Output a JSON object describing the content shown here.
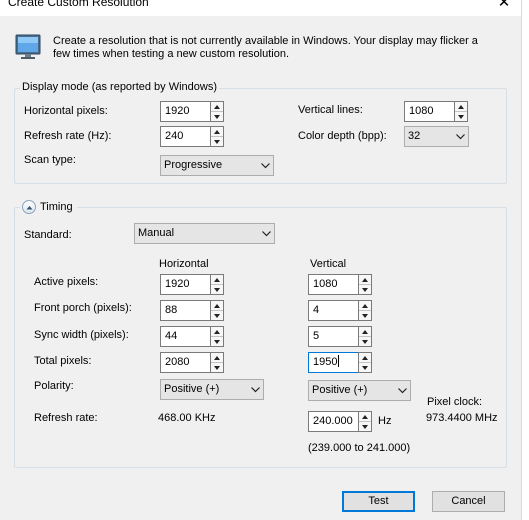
{
  "window": {
    "title": "Create Custom Resolution"
  },
  "icons": {
    "close": "close-icon",
    "monitor": "monitor-icon",
    "collapse": "chevron-up-icon",
    "dropdown": "chevron-down-icon"
  },
  "intro_text": "Create a resolution that is not currently available in Windows. Your display may flicker a few times when testing a new custom resolution.",
  "display_mode": {
    "legend": "Display mode (as reported by Windows)",
    "horizontal_pixels": {
      "label": "Horizontal pixels:",
      "value": "1920"
    },
    "vertical_lines": {
      "label": "Vertical lines:",
      "value": "1080"
    },
    "refresh_rate": {
      "label": "Refresh rate (Hz):",
      "value": "240"
    },
    "color_depth": {
      "label": "Color depth (bpp):",
      "value": "32"
    },
    "scan_type": {
      "label": "Scan type:",
      "value": "Progressive"
    }
  },
  "timing": {
    "legend": "Timing",
    "standard": {
      "label": "Standard:",
      "value": "Manual"
    },
    "col_horizontal": "Horizontal",
    "col_vertical": "Vertical",
    "active_pixels": {
      "label": "Active pixels:",
      "h": "1920",
      "v": "1080"
    },
    "front_porch": {
      "label": "Front porch (pixels):",
      "h": "88",
      "v": "4"
    },
    "sync_width": {
      "label": "Sync width (pixels):",
      "h": "44",
      "v": "5"
    },
    "total_pixels": {
      "label": "Total pixels:",
      "h": "2080",
      "v": "1950"
    },
    "polarity": {
      "label": "Polarity:",
      "h": "Positive (+)",
      "v": "Positive (+)"
    },
    "refresh_rate": {
      "label": "Refresh rate:",
      "h": "468.00 KHz",
      "v": "240.000",
      "unit": "Hz",
      "range": "(239.000 to 241.000)"
    },
    "pixel_clock": {
      "label": "Pixel clock:",
      "value": "973.4400 MHz"
    }
  },
  "buttons": {
    "test": "Test",
    "cancel": "Cancel"
  },
  "colors": {
    "accent": "#0078d7",
    "dialog_bg": "#f0f0f0",
    "group_border": "#d5dfe5"
  }
}
